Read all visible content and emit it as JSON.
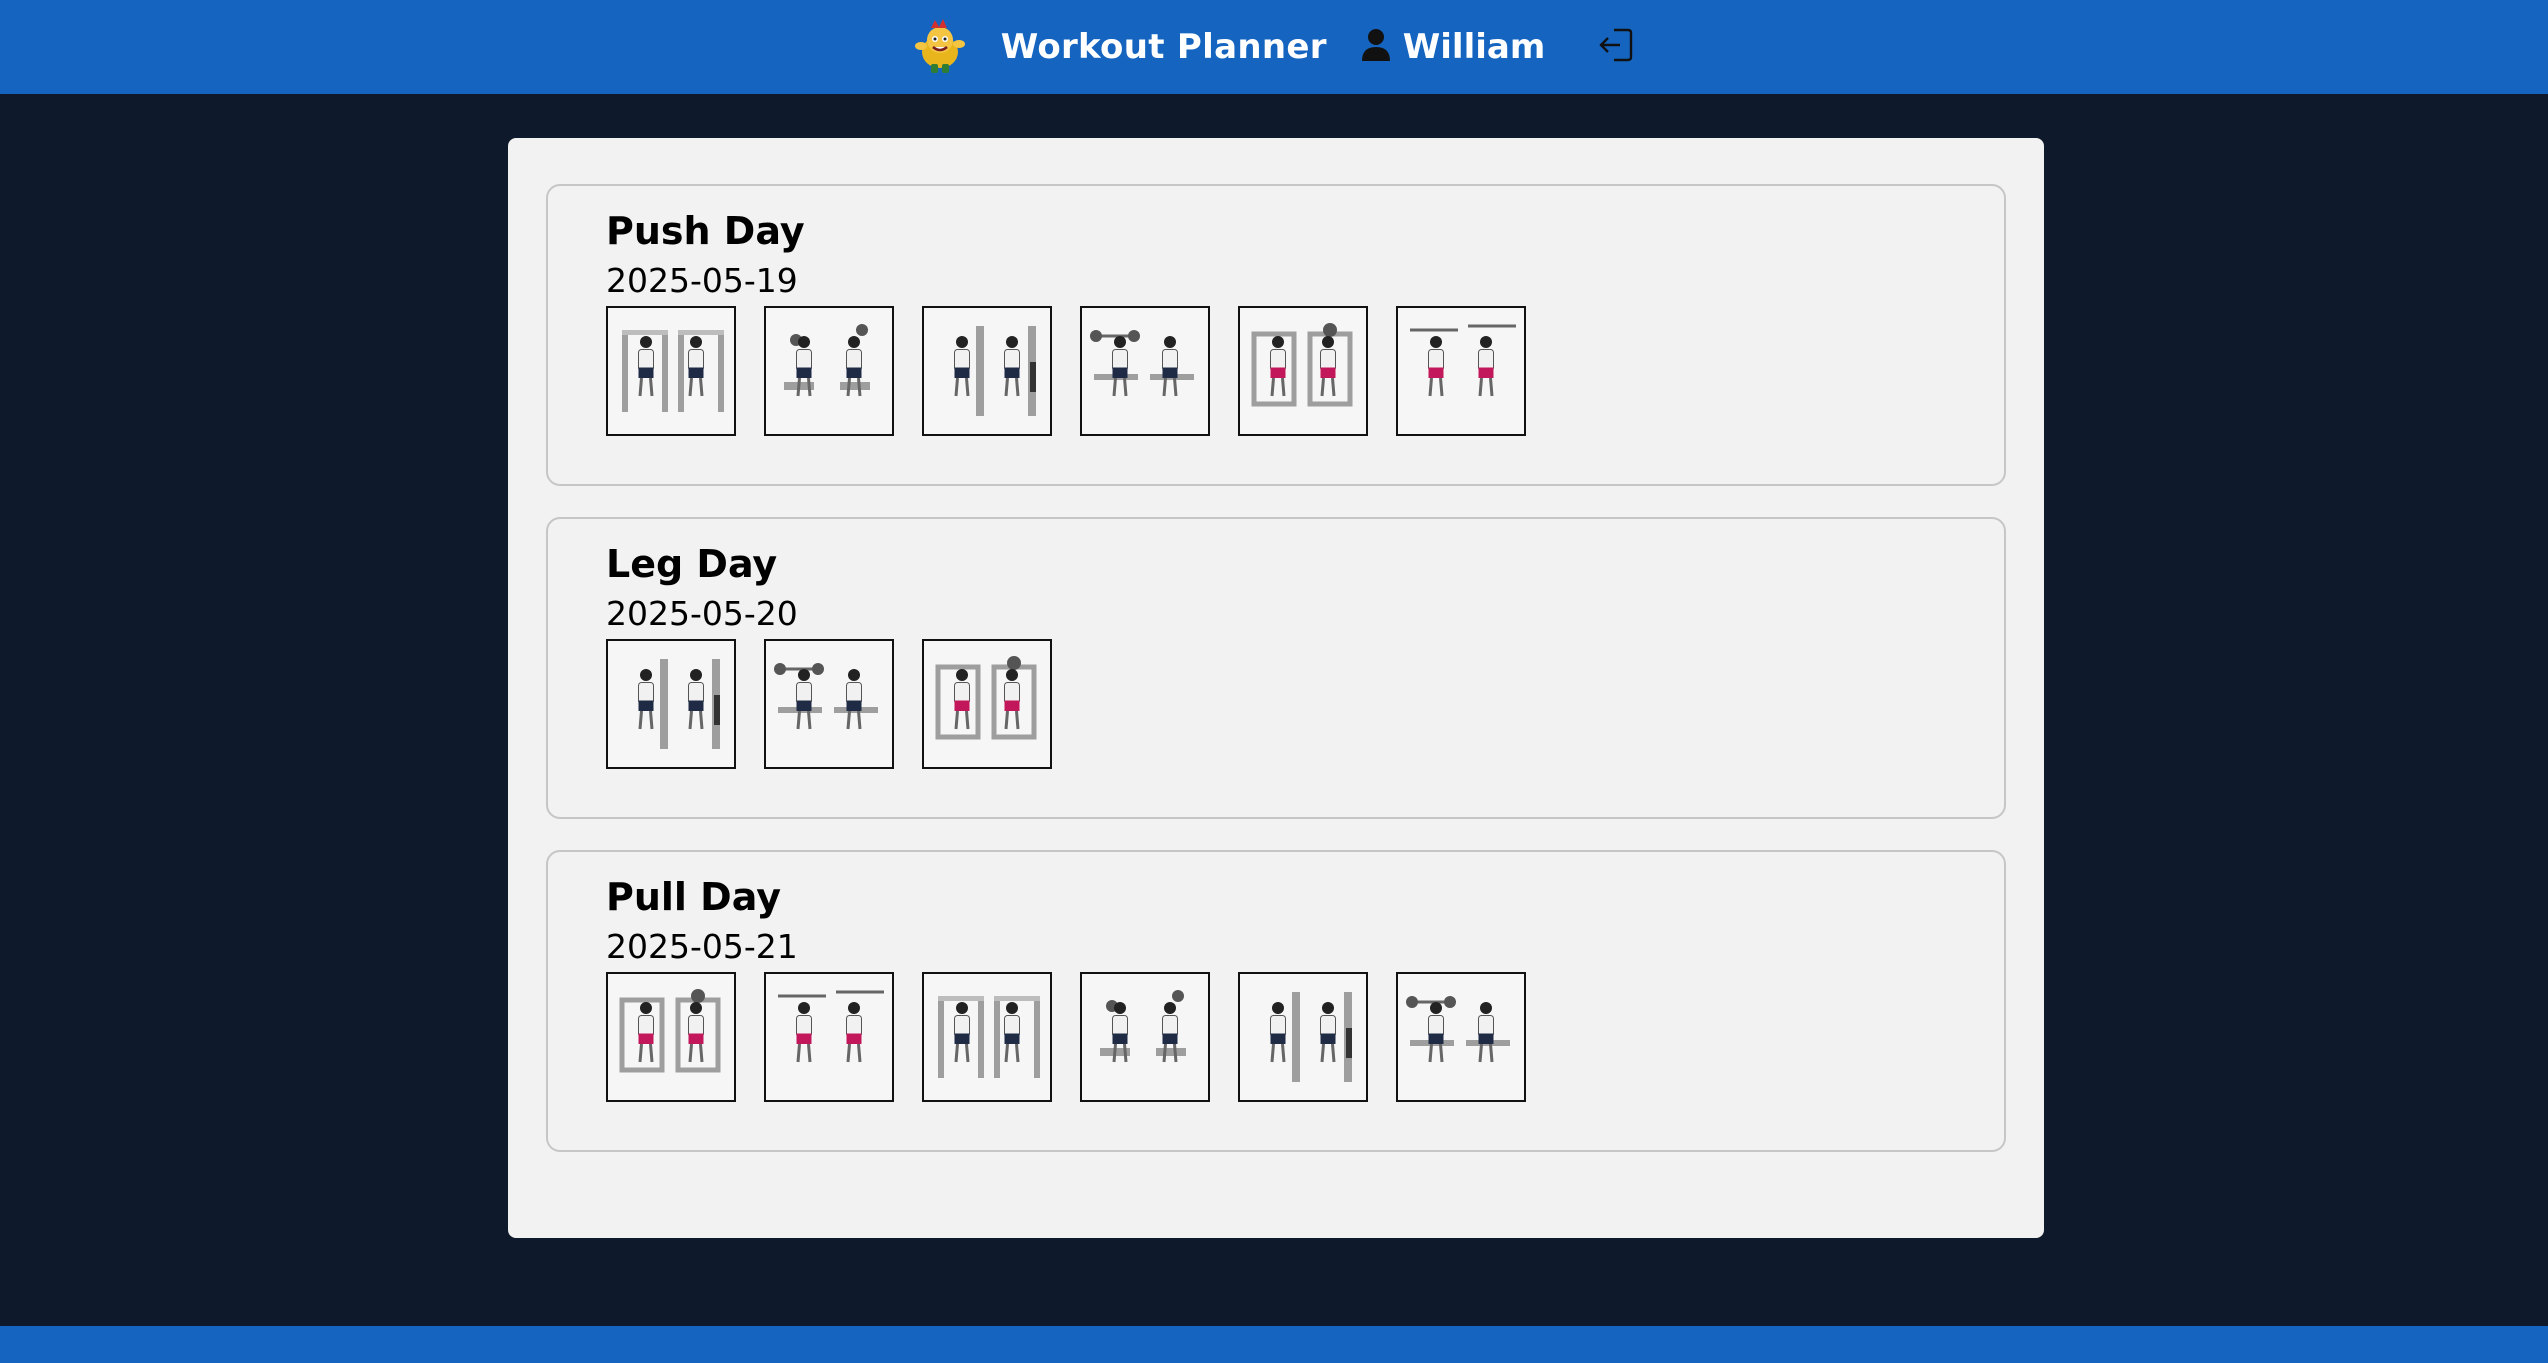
{
  "header": {
    "app_title": "Workout Planner",
    "user_name": "William",
    "logo_icon": "mascot-logo-icon",
    "user_icon": "user-icon",
    "logout_icon": "logout-icon"
  },
  "colors": {
    "header_bg": "#1565c0",
    "page_bg": "#0e1a2b",
    "panel_bg": "#f2f2f2",
    "card_border": "#c6c6c6"
  },
  "workouts": [
    {
      "title": "Push Day",
      "date": "2025-05-19",
      "exercises": [
        "exercise-illustration-icon",
        "exercise-illustration-icon",
        "exercise-illustration-icon",
        "exercise-illustration-icon",
        "exercise-illustration-icon",
        "exercise-illustration-icon"
      ]
    },
    {
      "title": "Leg Day",
      "date": "2025-05-20",
      "exercises": [
        "exercise-illustration-icon",
        "exercise-illustration-icon",
        "exercise-illustration-icon"
      ]
    },
    {
      "title": "Pull Day",
      "date": "2025-05-21",
      "exercises": [
        "exercise-illustration-icon",
        "exercise-illustration-icon",
        "exercise-illustration-icon",
        "exercise-illustration-icon",
        "exercise-illustration-icon",
        "exercise-illustration-icon"
      ]
    }
  ]
}
